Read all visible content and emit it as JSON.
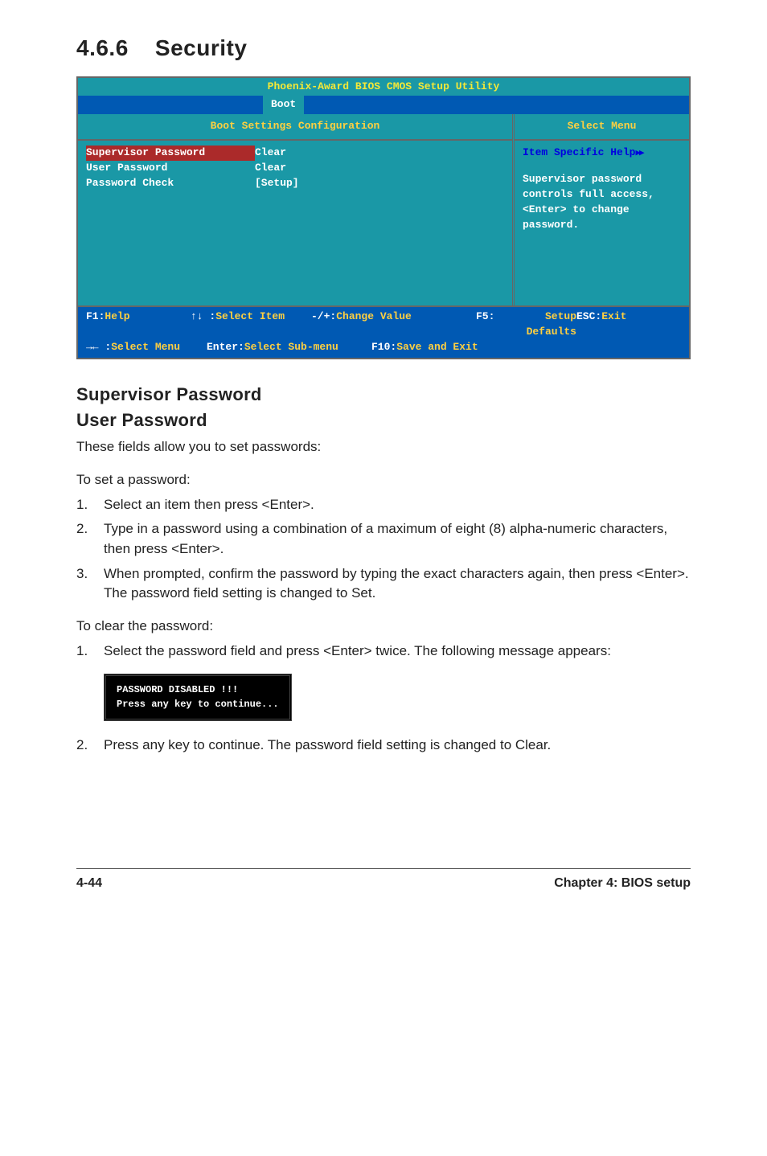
{
  "section": {
    "number": "4.6.6",
    "title": "Security"
  },
  "bios": {
    "title": "Phoenix-Award BIOS CMOS Setup Utility",
    "active_tab": "Boot",
    "panel_left_title": "Boot Settings Configuration",
    "panel_right_title": "Select Menu",
    "rows": [
      {
        "label": "Supervisor Password",
        "value": "Clear",
        "selected": true
      },
      {
        "label": "User Password",
        "value": "Clear",
        "selected": false
      },
      {
        "label": "Password Check",
        "value": "[Setup]",
        "selected": false
      }
    ],
    "help": {
      "heading": "Item Specific Help",
      "body": "Supervisor password controls full access, <Enter> to change password."
    },
    "footer": {
      "f1_key": "F1:",
      "f1_lbl": "Help",
      "esc_key": "ESC:",
      "esc_lbl": " Exit",
      "ud_key": "↑↓ :",
      "ud_lbl": " Select Item",
      "lr_key": "→← :",
      "lr_lbl": " Select Menu",
      "pm_key": "-/+:",
      "pm_lbl": " Change Value",
      "en_key": "Enter:",
      "en_lbl": " Select Sub-menu",
      "f5_key": "F5:",
      "f5_lbl": " Setup Defaults",
      "f10_key": "F10:",
      "f10_lbl": " Save and Exit"
    }
  },
  "headings": {
    "supervisor": "Supervisor Password",
    "user": "User Password"
  },
  "text": {
    "intro": "These fields allow you to set passwords:",
    "to_set": "To set a password:",
    "step1": "Select an item then press <Enter>.",
    "step2": "Type in a password using a combination of a maximum of eight (8) alpha-numeric characters, then press <Enter>.",
    "step3": "When prompted, confirm the password by typing the exact characters again, then press <Enter>. The password field setting is changed to Set.",
    "to_clear": "To clear the password:",
    "clear_step1": "Select the password field and press <Enter> twice. The following message appears:",
    "clear_step2": "Press any key to continue. The password field setting is changed to Clear."
  },
  "password_box": "PASSWORD DISABLED !!!\nPress any key to continue...",
  "footer": {
    "page": "4-44",
    "chapter": "Chapter 4: BIOS setup"
  }
}
